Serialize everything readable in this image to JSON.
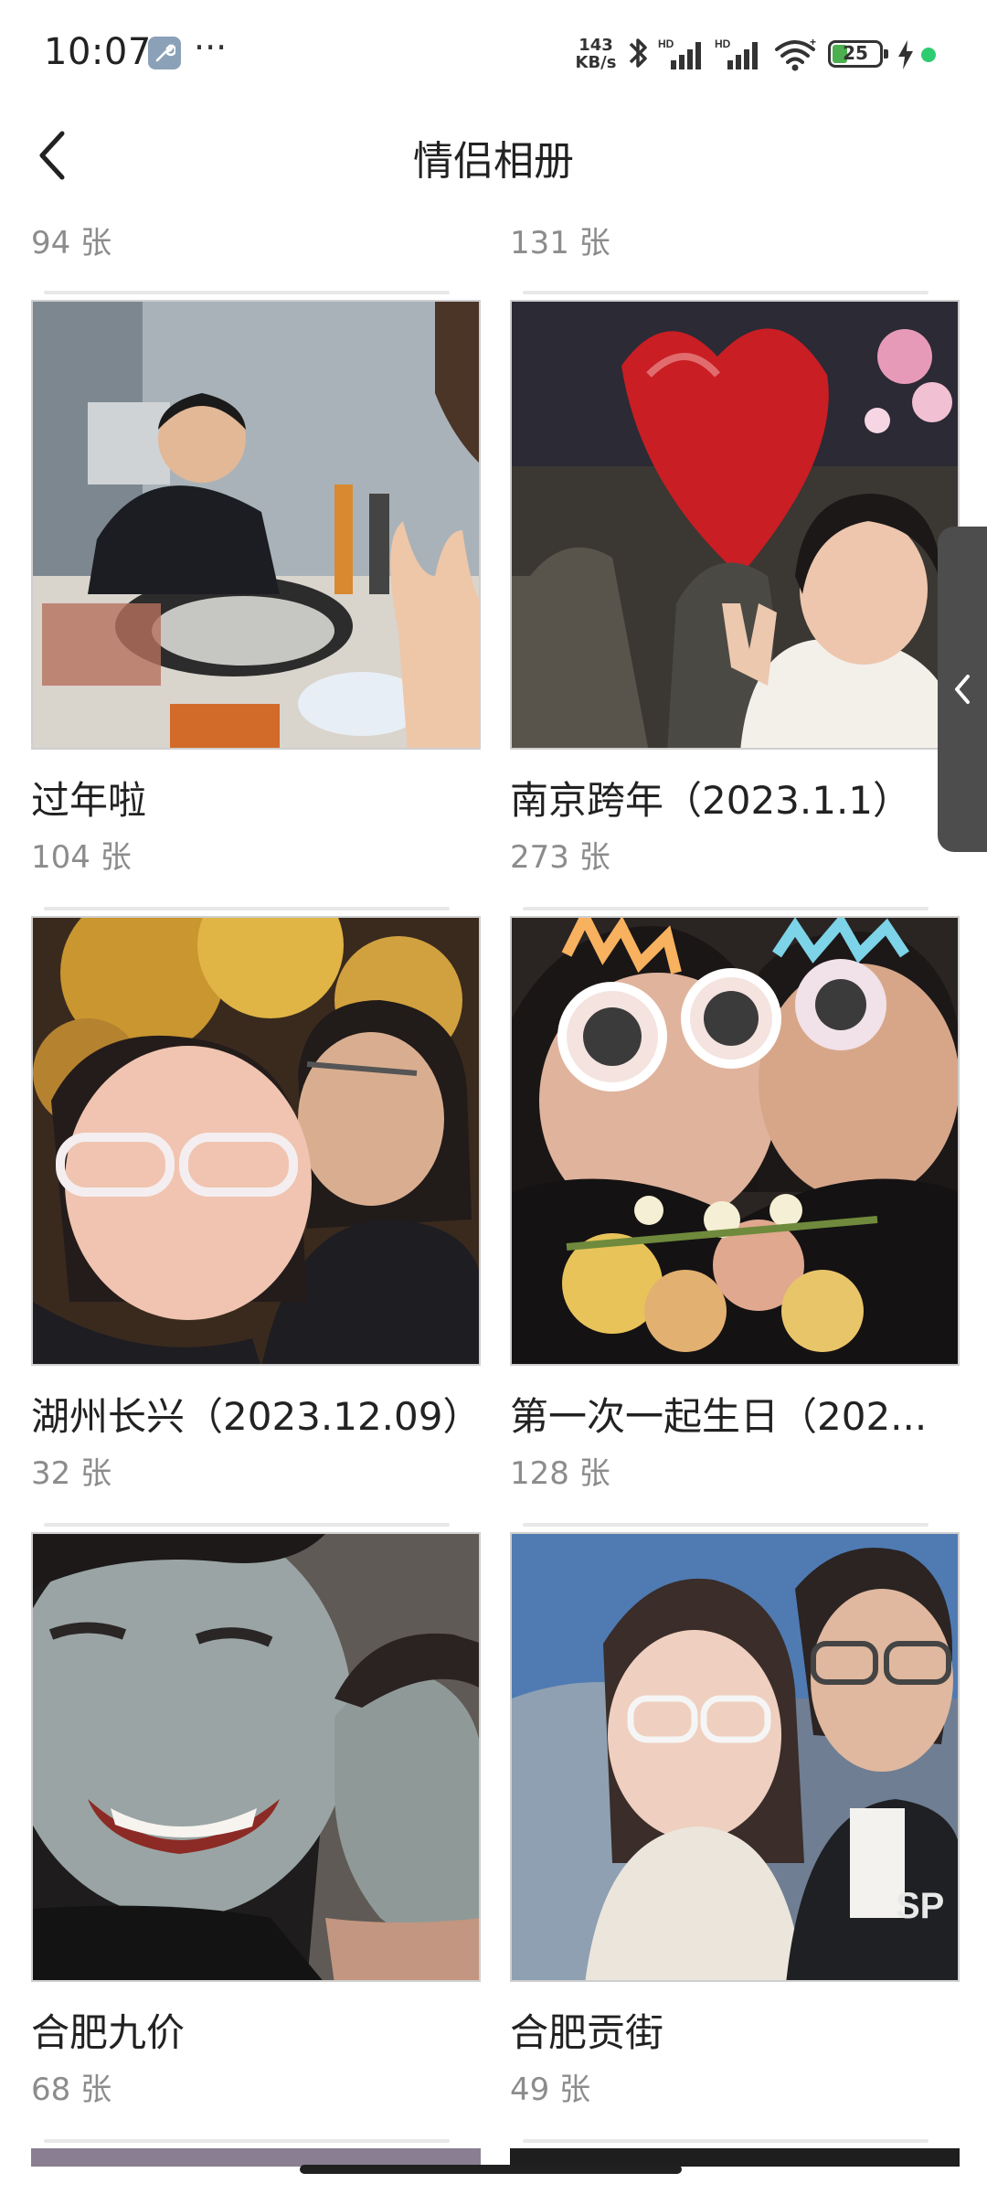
{
  "status": {
    "time": "10:07",
    "speed_value": "143",
    "speed_unit": "KB/s",
    "battery": "25",
    "icons": [
      "wrench-icon",
      "more-dots-icon",
      "bluetooth-icon",
      "hd-signal-icon",
      "hd-signal-icon",
      "wifi-icon",
      "battery-icon",
      "charging-bolt-icon",
      "green-dot-icon"
    ]
  },
  "header": {
    "title": "情侣相册",
    "back_icon": "chevron-left-icon"
  },
  "albums": [
    {
      "title": "",
      "count": "94 张"
    },
    {
      "title": "",
      "count": "131 张"
    },
    {
      "title": "过年啦",
      "count": "104 张"
    },
    {
      "title": "南京跨年（2023.1.1）",
      "count": "273 张"
    },
    {
      "title": "湖州长兴（2023.12.09）",
      "count": "32 张"
    },
    {
      "title": "第一次一起生日（202...",
      "count": "128 张"
    },
    {
      "title": "合肥九价",
      "count": "68 张"
    },
    {
      "title": "合肥贡街",
      "count": "49 张"
    }
  ],
  "side_handle": {
    "icon": "chevron-left-icon"
  },
  "colors": {
    "background": "#ffffff",
    "count_text": "#8c8c8c",
    "title_text": "#222222",
    "side_handle": "#4d4d4d",
    "status_dot": "#2ecc71"
  }
}
